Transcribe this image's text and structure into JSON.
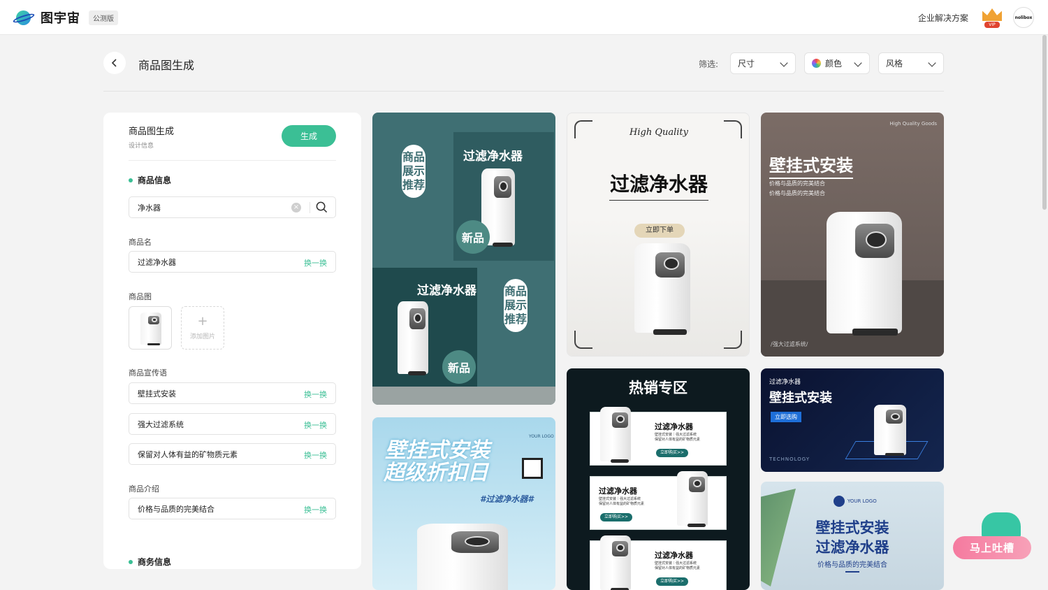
{
  "header": {
    "logo_text": "图宇宙",
    "beta_badge": "公测版",
    "enterprise_link": "企业解决方案",
    "vip_label": "VIP",
    "avatar_text": "nolibox"
  },
  "toolbar": {
    "back_icon": "chevron-left-icon",
    "title": "商品图生成",
    "filter_label": "筛选:",
    "filters": [
      {
        "label": "尺寸"
      },
      {
        "label": "颜色"
      },
      {
        "label": "风格"
      }
    ]
  },
  "panel": {
    "title": "商品图生成",
    "subtitle": "设计信息",
    "generate_label": "生成",
    "product_section": "商品信息",
    "search_value": "净水器",
    "name_label": "商品名",
    "name_value": "过滤净水器",
    "swap_label": "换一换",
    "image_label": "商品图",
    "add_image_label": "添加图片",
    "slogan_label": "商品宣传语",
    "slogans": [
      "壁挂式安装",
      "强大过滤系统",
      "保留对人体有益的矿物质元素"
    ],
    "intro_label": "商品介绍",
    "intro_value": "价格与品质的完美结合",
    "business_section": "商务信息",
    "accent": "#3bbf95"
  },
  "cards": {
    "c1": {
      "title": "过滤净水器",
      "vertical": "商品展示推荐",
      "badge": "新品"
    },
    "c2": {
      "script": "High Quality",
      "title": "过滤净水器",
      "cta": "立即下单"
    },
    "c3": {
      "tag": "High Quality Goods",
      "title": "壁挂式安装",
      "line1": "价格与品质的完美结合",
      "line2": "价格与品质的完美结合",
      "footer": "/强大过滤系统/"
    },
    "c4": {
      "line1": "壁挂式安装",
      "line2": "超级折扣日",
      "hashtag": "#过滤净水器#",
      "logo": "YOUR LOGO"
    },
    "c5": {
      "banner": "热销专区",
      "item_title": "过滤净水器",
      "item_desc1": "壁挂式安装｜强大过滤系统",
      "item_desc2": "保留对人体有益的矿物质元素",
      "cta": "立即购买>>"
    },
    "c6": {
      "small": "过滤净水器",
      "title": "壁挂式安装",
      "cta": "立即选购",
      "footer": "TECHNOLOGY"
    },
    "c7": {
      "logo": "YOUR LOGO",
      "line1": "壁挂式安装",
      "line2": "过滤净水器",
      "line3": "价格与品质的完美结合"
    }
  },
  "feedback": {
    "label": "马上吐槽"
  }
}
